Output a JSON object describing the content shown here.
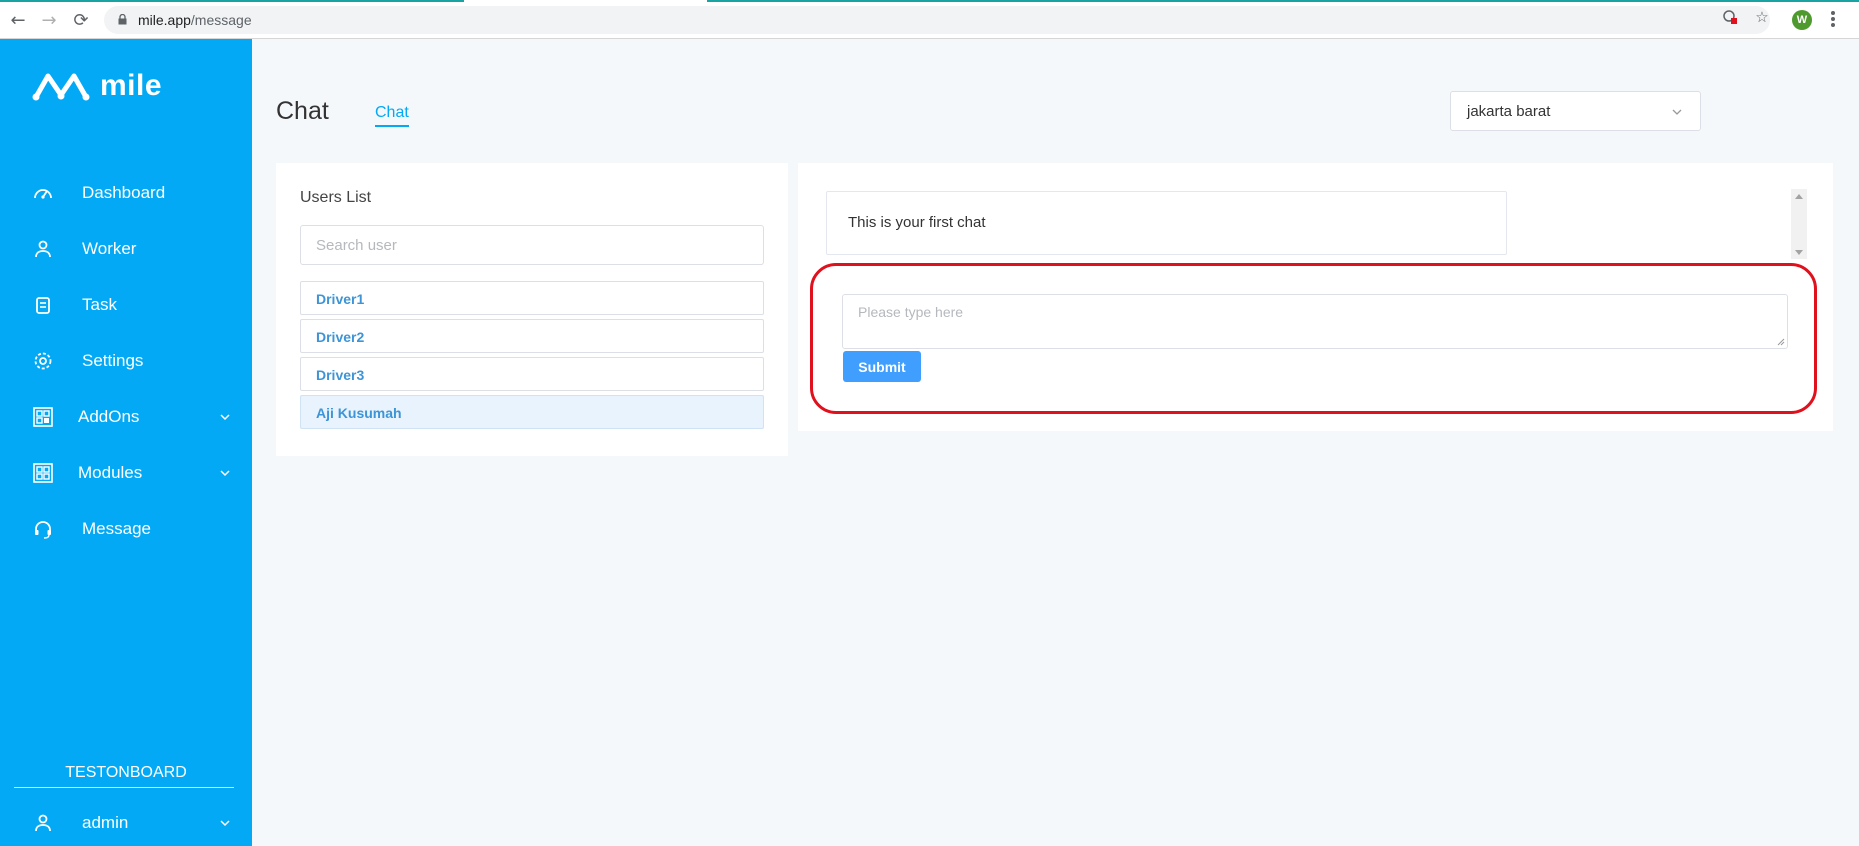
{
  "browser": {
    "url_host": "mile.app",
    "url_path": "/message",
    "profile_initial": "W"
  },
  "sidebar": {
    "brand": "mile",
    "items": [
      {
        "label": "Dashboard",
        "icon": "speedometer-icon"
      },
      {
        "label": "Worker",
        "icon": "user-icon"
      },
      {
        "label": "Task",
        "icon": "clipboard-icon"
      },
      {
        "label": "Settings",
        "icon": "gear-icon"
      },
      {
        "label": "AddOns",
        "icon": "addons-grid-icon"
      },
      {
        "label": "Modules",
        "icon": "modules-grid-icon"
      },
      {
        "label": "Message",
        "icon": "headset-icon"
      }
    ],
    "organization": "TESTONBOARD",
    "user": "admin"
  },
  "header": {
    "title": "Chat",
    "tab": "Chat",
    "city_select": "jakarta barat"
  },
  "users_panel": {
    "title": "Users List",
    "search_placeholder": "Search user",
    "users": [
      "Driver1",
      "Driver2",
      "Driver3",
      "Aji Kusumah"
    ],
    "selected_user": "Aji Kusumah"
  },
  "chat_panel": {
    "first_message": "This is your first chat",
    "input_placeholder": "Please type here",
    "submit_label": "Submit"
  },
  "colors": {
    "sidebar": "#03a9f4",
    "accent": "#409eff",
    "highlight": "#e0101c"
  }
}
